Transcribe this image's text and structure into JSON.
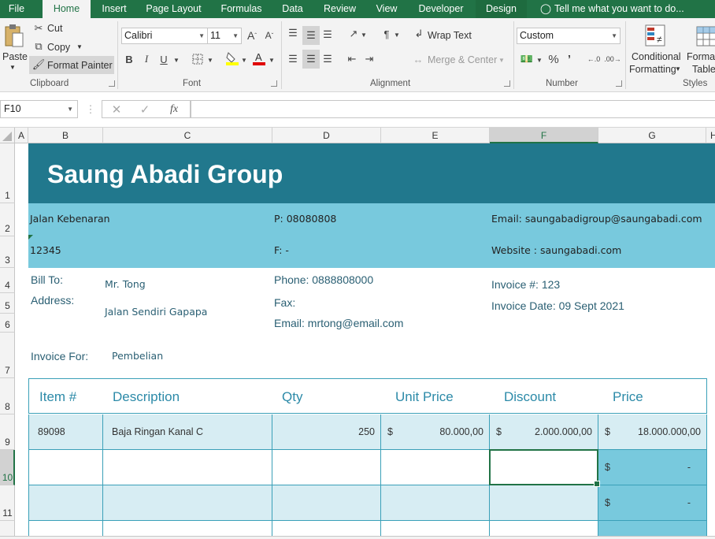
{
  "ribbon_tabs": [
    "File",
    "Home",
    "Insert",
    "Page Layout",
    "Formulas",
    "Data",
    "Review",
    "View",
    "Developer",
    "Design"
  ],
  "tell_me": "Tell me what you want to do...",
  "clipboard": {
    "paste": "Paste",
    "cut": "Cut",
    "copy": "Copy",
    "format_painter": "Format Painter",
    "label": "Clipboard"
  },
  "font": {
    "name": "Calibri",
    "size": "11",
    "label": "Font"
  },
  "alignment": {
    "wrap_text": "Wrap Text",
    "merge_center": "Merge & Center",
    "label": "Alignment"
  },
  "number": {
    "format": "Custom",
    "label": "Number"
  },
  "styles": {
    "conditional_1": "Conditional",
    "conditional_2": "Formatting",
    "format_1": "Format",
    "format_2": "Table",
    "label": "Styles"
  },
  "formula_bar": {
    "name_box": "F10",
    "formula": ""
  },
  "columns": [
    "A",
    "B",
    "C",
    "D",
    "E",
    "F",
    "G",
    "H"
  ],
  "rows": [
    "1",
    "2",
    "3",
    "4",
    "5",
    "6",
    "7",
    "8",
    "9",
    "10",
    "11"
  ],
  "sheet": {
    "title": "Saung Abadi Group",
    "street": "Jalan Kebenaran",
    "zip": "12345",
    "phone": "P: 08080808",
    "fax": "F: -",
    "email": "Email: saungabadigroup@saungabadi.com",
    "website": "Website : saungabadi.com",
    "bill_to_label": "Bill To:",
    "bill_to_value": "Mr. Tong",
    "address_label": "Address:",
    "address_value": "Jalan Sendiri Gapapa",
    "cust_phone": "Phone: 0888808000",
    "cust_fax": "Fax:",
    "cust_email": "Email:  mrtong@email.com",
    "invoice_no": "Invoice #: 123",
    "invoice_date": "Invoice Date: 09 Sept 2021",
    "invoice_for_label": "Invoice For:",
    "invoice_for_value": "Pembelian"
  },
  "table": {
    "headers": [
      "Item #",
      "Description",
      "Qty",
      "Unit Price",
      "Discount",
      "Price"
    ],
    "rows": [
      {
        "item": "89098",
        "desc": "Baja Ringan Kanal C",
        "qty": "250",
        "unit_cur": "$",
        "unit": "80.000,00",
        "disc_cur": "$",
        "disc": "2.000.000,00",
        "price_cur": "$",
        "price": "18.000.000,00"
      },
      {
        "item": "",
        "desc": "",
        "qty": "",
        "unit_cur": "",
        "unit": "",
        "disc_cur": "",
        "disc": "",
        "price_cur": "$",
        "price": "-"
      },
      {
        "item": "",
        "desc": "",
        "qty": "",
        "unit_cur": "",
        "unit": "",
        "disc_cur": "",
        "disc": "",
        "price_cur": "$",
        "price": "-"
      }
    ]
  },
  "colors": {
    "ribbon_green": "#217346",
    "banner": "#21788d",
    "info_band": "#78c9dd",
    "row_light": "#d7edf3",
    "header_text": "#2c8aa8"
  }
}
